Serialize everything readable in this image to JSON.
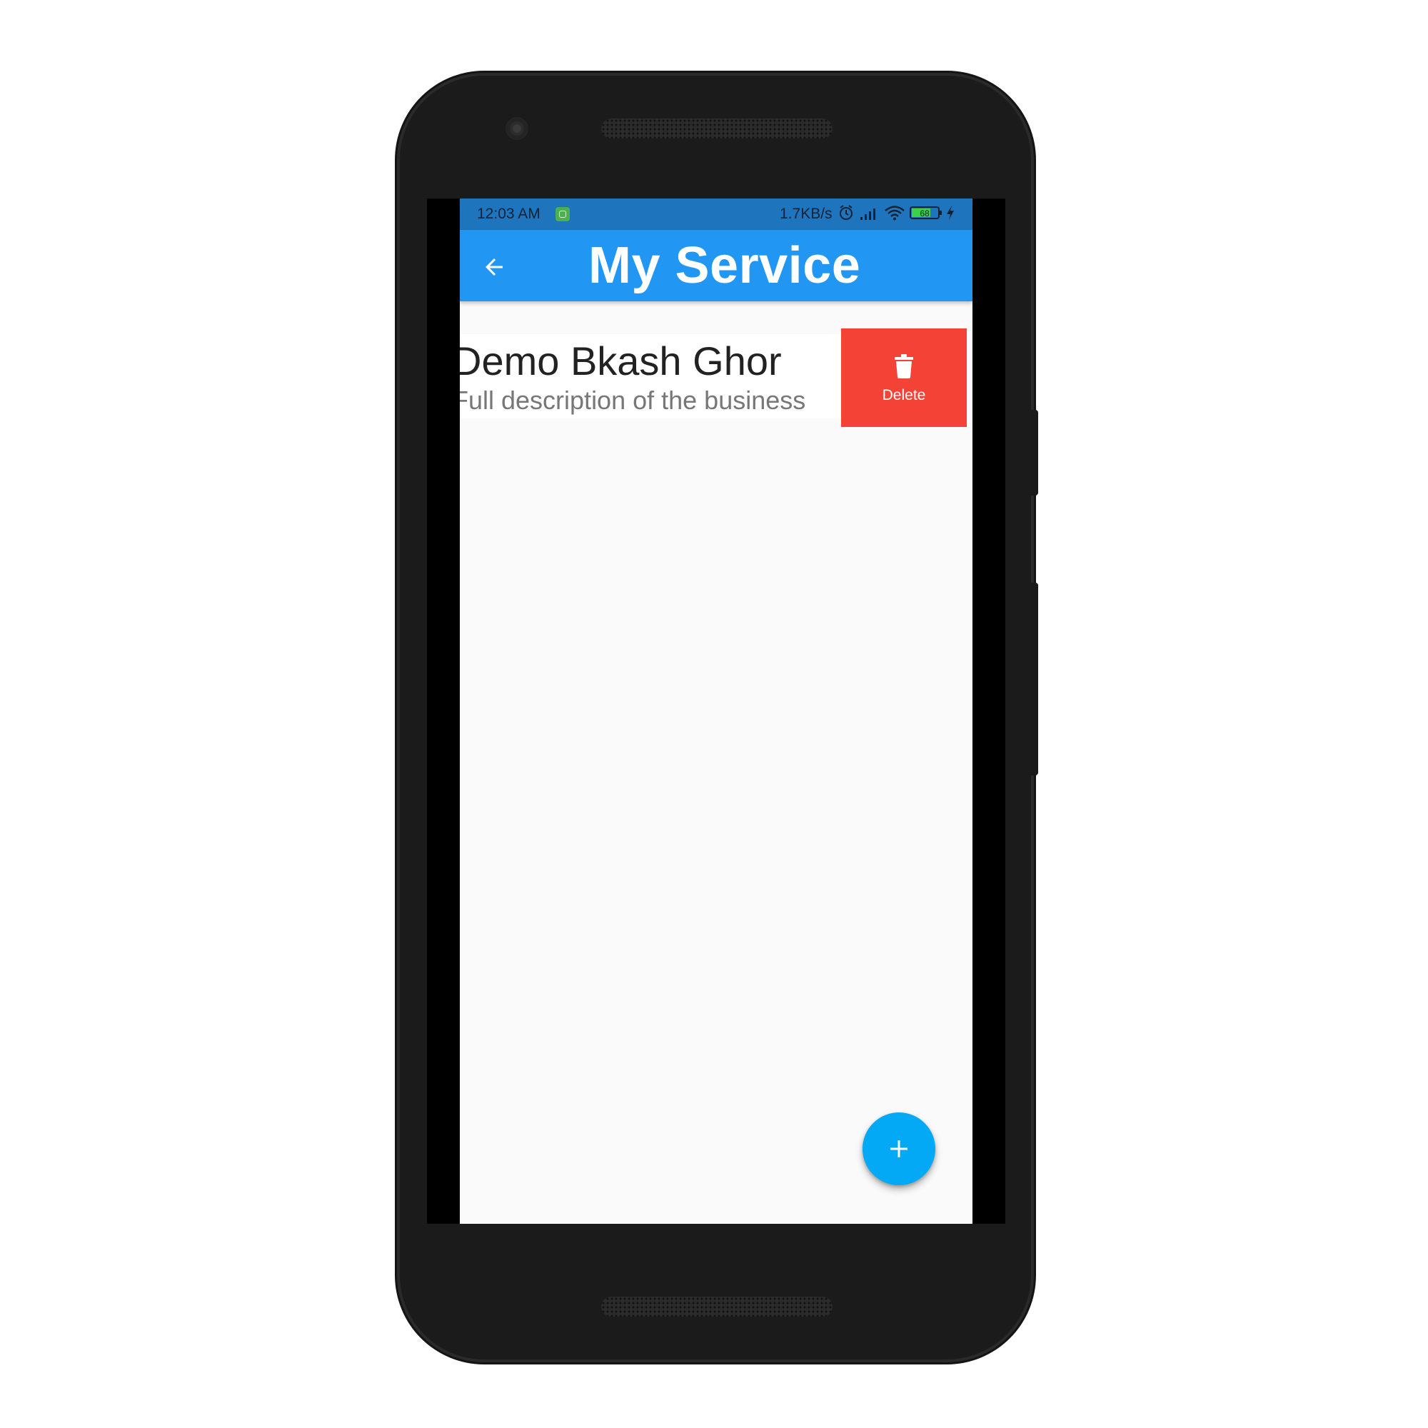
{
  "status_bar": {
    "time": "12:03 AM",
    "network_speed": "1.7KB/s",
    "battery_level": "68",
    "icons": [
      "app-notification-icon",
      "alarm-icon",
      "signal-icon",
      "wifi-icon",
      "battery-icon",
      "charging-icon"
    ]
  },
  "app_bar": {
    "title": "My Service",
    "back_icon": "arrow-back-icon"
  },
  "services": [
    {
      "title": "Demo Bkash Ghor",
      "subtitle": "Full description of the business",
      "action": {
        "label": "Delete",
        "icon": "trash-icon",
        "color": "#f44336"
      }
    }
  ],
  "fab": {
    "icon": "plus-icon",
    "color": "#03a9f4"
  },
  "colors": {
    "app_bar": "#2196f3",
    "status_bar": "#1e75bd",
    "background": "#fafafa"
  }
}
